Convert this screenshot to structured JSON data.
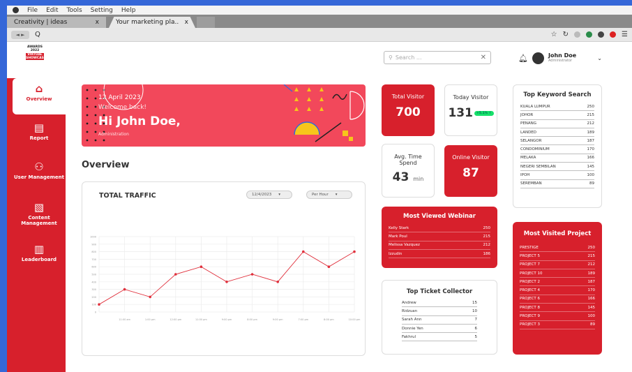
{
  "menubar": [
    "File",
    "Edit",
    "Tools",
    "Setting",
    "Help"
  ],
  "tabs": [
    {
      "title": "Creativity | ideas",
      "close": "x"
    },
    {
      "title": "Your marketing pla..",
      "close": "x"
    }
  ],
  "address": {
    "back": "◄ ►",
    "query_icon": "Q"
  },
  "logo": {
    "line1": "AWARDS",
    "line2": "2022",
    "line3": "VIRTUAL SHOWCASE"
  },
  "sidebar": {
    "items": [
      {
        "label": "Overview",
        "icon": "home-icon",
        "glyph": "⌂"
      },
      {
        "label": "Report",
        "icon": "document-icon",
        "glyph": "▤"
      },
      {
        "label": "User Management",
        "icon": "users-icon",
        "glyph": "⚇"
      },
      {
        "label": "Content Management",
        "icon": "content-icon",
        "glyph": "▧"
      },
      {
        "label": "Leaderboard",
        "icon": "leaderboard-icon",
        "glyph": "▥"
      }
    ]
  },
  "header": {
    "search_placeholder": "Search ...",
    "user_name": "John Doe",
    "user_role": "Administrator"
  },
  "banner": {
    "date": "12 April 2023",
    "welcome": "Welcome back!",
    "greeting": "Hi John Doe,",
    "role": "Administration"
  },
  "section_title": "Overview",
  "traffic": {
    "title": "TOTAL TRAFFIC",
    "date_select": "12/4/2023",
    "period_select": "Per Hour"
  },
  "chart_data": {
    "type": "line",
    "title": "TOTAL TRAFFIC",
    "x": [
      "10:00 am",
      "11:00 am",
      "1:00 pm",
      "12:00 pm",
      "11:00 pm",
      "9:00 pm",
      "8:00 pm",
      "9:00 pm",
      "7:00 pm",
      "8:00 pm",
      "10:00 pm"
    ],
    "values": [
      100,
      300,
      200,
      500,
      600,
      400,
      500,
      400,
      800,
      600,
      800
    ],
    "ylim": [
      0,
      1000
    ],
    "yticks": [
      0,
      100,
      200,
      300,
      400,
      500,
      600,
      700,
      800,
      900,
      1000
    ],
    "color": "#e0303c",
    "grid": true
  },
  "stats": {
    "total_visitor": {
      "label": "Total Visitor",
      "value": "700"
    },
    "today_visitor": {
      "label": "Today Visitor",
      "value": "131",
      "badge": "+5.1% ↑"
    },
    "avg_time": {
      "label": "Avg. Time Spend",
      "value": "43",
      "unit": "min"
    },
    "online_visitor": {
      "label": "Online Visitor",
      "value": "87"
    }
  },
  "webinar": {
    "title": "Most Viewed Webinar",
    "rows": [
      [
        "Kelly Stark",
        "250"
      ],
      [
        "Mark Poul",
        "215"
      ],
      [
        "Melissa Vazquez",
        "212"
      ],
      [
        "Izzudin",
        "186"
      ]
    ]
  },
  "ticket": {
    "title": "Top Ticket Collector",
    "rows": [
      [
        "Andrew",
        "15"
      ],
      [
        "Ridzuan",
        "10"
      ],
      [
        "Sarah Ann",
        "7"
      ],
      [
        "Donnie Yen",
        "6"
      ],
      [
        "Fakhrul",
        "5"
      ]
    ]
  },
  "keyword": {
    "title": "Top Keyword Search",
    "rows": [
      [
        "KUALA LUMPUR",
        "250"
      ],
      [
        "JOHOR",
        "215"
      ],
      [
        "PENANG",
        "212"
      ],
      [
        "LANDED",
        "189"
      ],
      [
        "SELANGOR",
        "187"
      ],
      [
        "CONDOMINIUM",
        "170"
      ],
      [
        "MELAKA",
        "166"
      ],
      [
        "NEGERI SEMBILAN",
        "145"
      ],
      [
        "IPOH",
        "100"
      ],
      [
        "SEREMBAN",
        "89"
      ]
    ]
  },
  "project": {
    "title": "Most Visited Project",
    "rows": [
      [
        "PRESTIGE",
        "250"
      ],
      [
        "PROJECT 5",
        "215"
      ],
      [
        "PROJECT 7",
        "212"
      ],
      [
        "PROJECT 10",
        "189"
      ],
      [
        "PROJECT 2",
        "187"
      ],
      [
        "PROJECT 4",
        "170"
      ],
      [
        "PROJECT 6",
        "166"
      ],
      [
        "PROJECT 8",
        "145"
      ],
      [
        "PROJECT 9",
        "100"
      ],
      [
        "PROJECT 3",
        "89"
      ]
    ]
  }
}
